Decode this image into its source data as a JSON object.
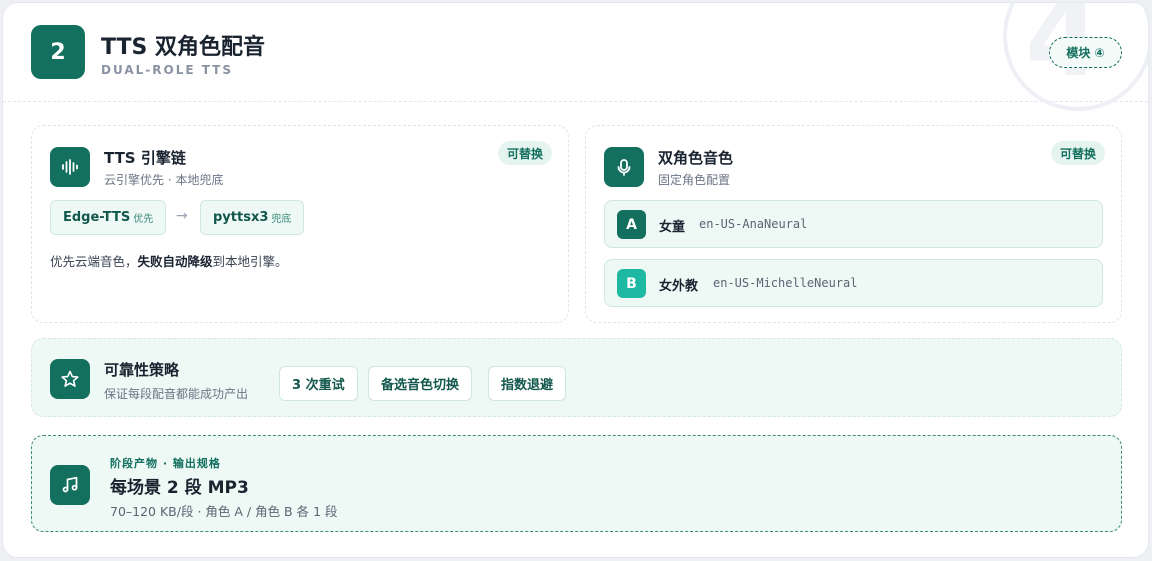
{
  "header": {
    "step_number": "2",
    "title": "TTS 双角色配音",
    "subtitle": "DUAL-ROLE TTS",
    "watermark_number": "4",
    "module_tag": "模块 ④"
  },
  "engine_panel": {
    "icon": "waveform-icon",
    "title": "TTS 引擎链",
    "subtitle": "云引擎优先 · 本地兜底",
    "swap_tag": "可替换",
    "chain": [
      {
        "name": "Edge-TTS",
        "note": "优先"
      },
      {
        "name": "pyttsx3",
        "note": "兜底"
      }
    ],
    "arrow": "→",
    "desc_before": "优先云端音色，",
    "desc_bold": "失败自动降级",
    "desc_after": "到本地引擎。"
  },
  "voice_panel": {
    "icon": "microphone-icon",
    "title": "双角色音色",
    "subtitle": "固定角色配置",
    "swap_tag": "可替换",
    "voices": [
      {
        "letter": "A",
        "role": "女童",
        "voice_id": "en-US-AnaNeural",
        "color": "#136f5e"
      },
      {
        "letter": "B",
        "role": "女外教",
        "voice_id": "en-US-MichelleNeural",
        "color": "#1fb8a3"
      }
    ]
  },
  "strategy_panel": {
    "icon": "star-icon",
    "title": "可靠性策略",
    "subtitle": "保证每段配音都能成功产出",
    "chips": [
      "3 次重试",
      "备选音色切换",
      "指数退避"
    ]
  },
  "output_panel": {
    "icon": "music-note-icon",
    "kicker": "阶段产物 · 输出规格",
    "title": "每场景 2 段 MP3",
    "detail": "70–120 KB/段 · 角色 A / 角色 B 各 1 段"
  },
  "colors": {
    "accent": "#136f5e",
    "accent_light": "#1fb8a3",
    "panel_tint": "#eef8f5"
  }
}
